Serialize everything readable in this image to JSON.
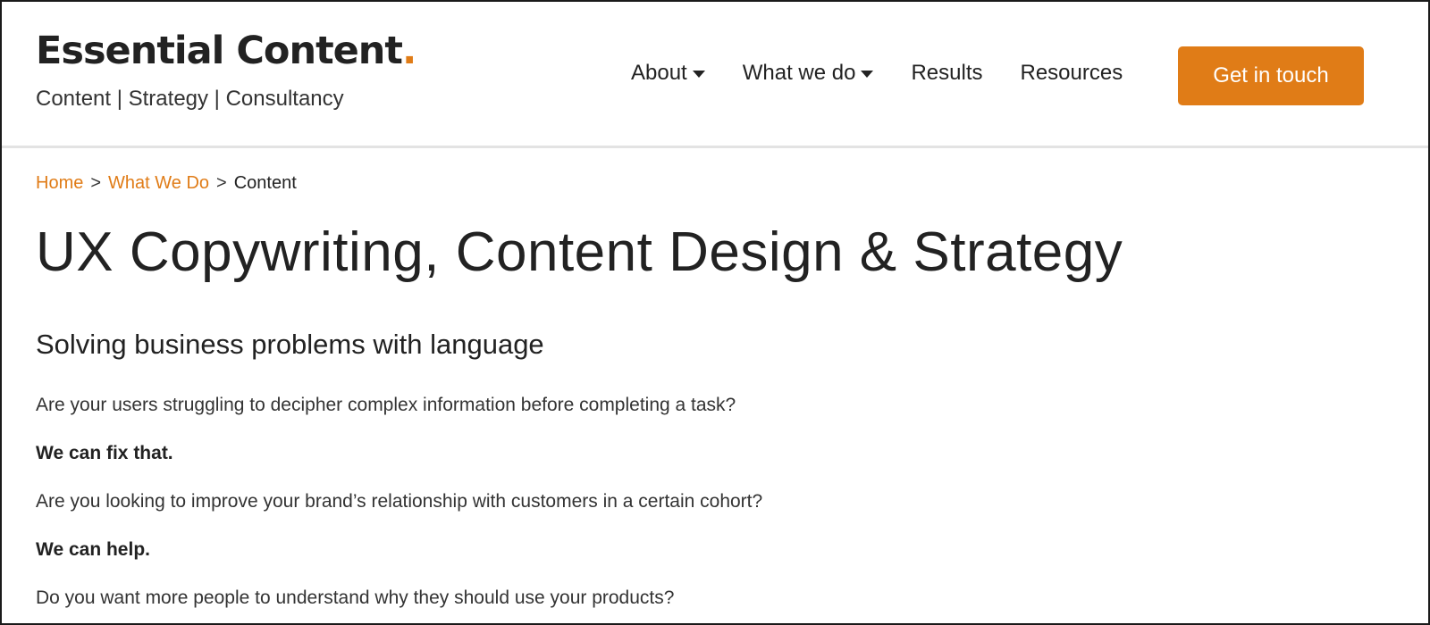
{
  "header": {
    "logo_title": "Essential Content",
    "logo_dot": ".",
    "tagline": "Content | Strategy | Consultancy",
    "nav": [
      {
        "label": "About",
        "has_dropdown": true
      },
      {
        "label": "What we do",
        "has_dropdown": true
      },
      {
        "label": "Results",
        "has_dropdown": false
      },
      {
        "label": "Resources",
        "has_dropdown": false
      }
    ],
    "cta_label": "Get in touch"
  },
  "breadcrumb": {
    "home": "Home",
    "separator": ">",
    "what_we_do": "What We Do",
    "current": "Content"
  },
  "main": {
    "title": "UX Copywriting, Content Design & Strategy",
    "subtitle": "Solving business problems with language",
    "paragraphs": [
      {
        "text": "Are your users struggling to decipher complex information before completing a task?",
        "bold": false
      },
      {
        "text": "We can fix that.",
        "bold": true
      },
      {
        "text": "Are you looking to improve your brand’s relationship with customers in a certain cohort?",
        "bold": false
      },
      {
        "text": "We can help.",
        "bold": true
      },
      {
        "text": "Do you want more people to understand why they should use your products?",
        "bold": false
      }
    ]
  },
  "colors": {
    "accent": "#e07c17",
    "text": "#222222",
    "divider": "#e3e3e3"
  },
  "icons": {
    "dropdown": "caret-down-icon"
  }
}
